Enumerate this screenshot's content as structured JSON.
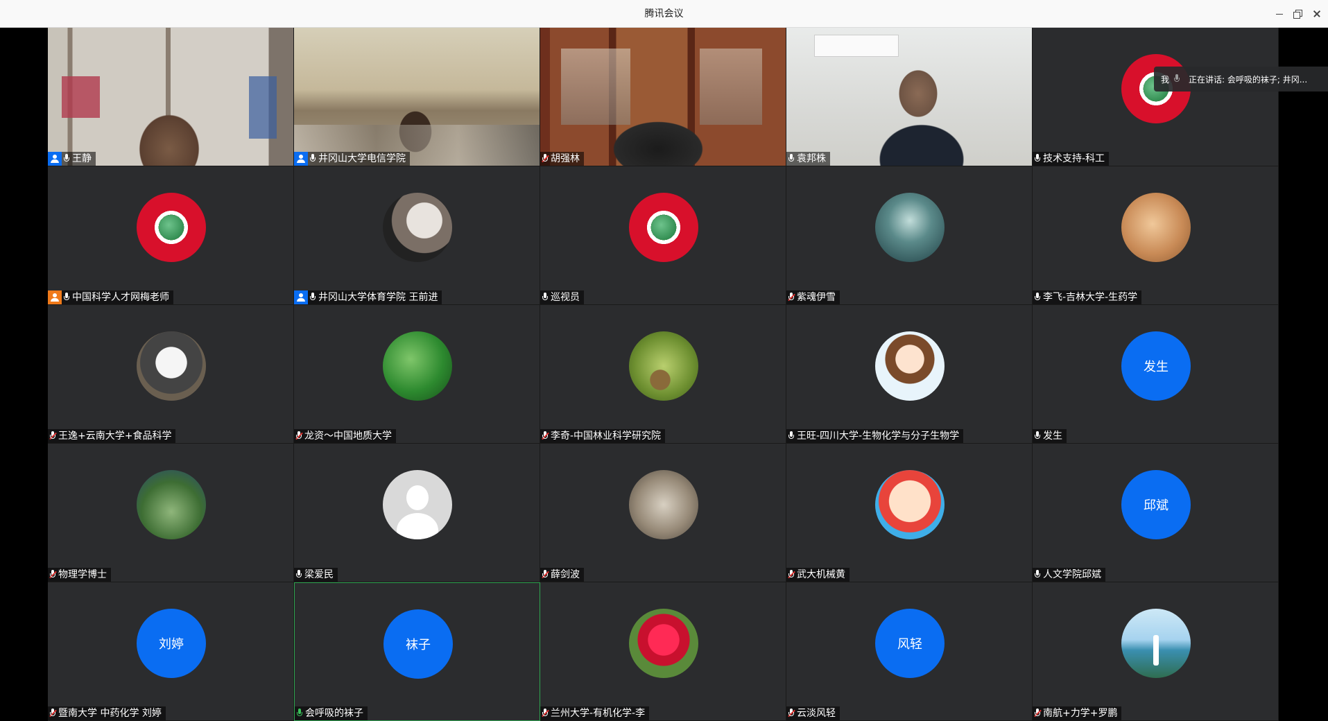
{
  "window": {
    "title": "腾讯会议"
  },
  "speaking": {
    "me_label": "我",
    "text": "正在讲话: 会呼吸的袜子; 井冈..."
  },
  "participants": [
    {
      "name": "王静",
      "badge": "host",
      "mic": "on",
      "view": "video",
      "style": "v1"
    },
    {
      "name": "井冈山大学电信学院",
      "badge": "host",
      "mic": "on",
      "view": "video",
      "style": "v2"
    },
    {
      "name": "胡强林",
      "badge": "",
      "mic": "muted",
      "view": "video",
      "style": "v3"
    },
    {
      "name": "袁邦株",
      "badge": "",
      "mic": "on",
      "view": "video",
      "style": "v4"
    },
    {
      "name": "技术支持-科工",
      "badge": "",
      "mic": "on",
      "view": "avatar",
      "avatar": "av-logo"
    },
    {
      "name": "中国科学人才网梅老师",
      "badge": "cohost",
      "mic": "on",
      "view": "avatar",
      "avatar": "av-logo"
    },
    {
      "name": "井冈山大学体育学院 王前进",
      "badge": "host",
      "mic": "on",
      "view": "avatar",
      "avatar": "av-portrait"
    },
    {
      "name": "巡视员",
      "badge": "",
      "mic": "on",
      "view": "avatar",
      "avatar": "av-logo"
    },
    {
      "name": "紫魂伊雪",
      "badge": "",
      "mic": "muted",
      "view": "avatar",
      "avatar": "av-wave"
    },
    {
      "name": "李飞-吉林大学-生药学",
      "badge": "",
      "mic": "on",
      "view": "avatar",
      "avatar": "av-cat"
    },
    {
      "name": "王逸+云南大学+食品科学",
      "badge": "",
      "mic": "muted",
      "view": "avatar",
      "avatar": "av-cartoon"
    },
    {
      "name": "龙资～中国地质大学",
      "badge": "",
      "mic": "muted",
      "view": "avatar",
      "avatar": "av-clover"
    },
    {
      "name": "李奇-中国林业科学研究院",
      "badge": "",
      "mic": "muted",
      "view": "avatar",
      "avatar": "av-squirrel"
    },
    {
      "name": "王旺-四川大学-生物化学与分子生物学",
      "badge": "",
      "mic": "on",
      "view": "avatar",
      "avatar": "av-boy"
    },
    {
      "name": "发生",
      "badge": "",
      "mic": "on",
      "view": "text",
      "avatar_text": "发生"
    },
    {
      "name": "物理学博士",
      "badge": "",
      "mic": "muted",
      "view": "avatar",
      "avatar": "av-plant"
    },
    {
      "name": "梁爱民",
      "badge": "",
      "mic": "on",
      "view": "avatar",
      "avatar": "av-default"
    },
    {
      "name": "薛剑波",
      "badge": "",
      "mic": "muted",
      "view": "avatar",
      "avatar": "av-hedgehog"
    },
    {
      "name": "武大机械黄",
      "badge": "",
      "mic": "muted",
      "view": "avatar",
      "avatar": "av-shin"
    },
    {
      "name": "人文学院邱斌",
      "badge": "",
      "mic": "on",
      "view": "text",
      "avatar_text": "邱斌"
    },
    {
      "name": "暨南大学  中药化学   刘婷",
      "badge": "",
      "mic": "muted",
      "view": "text",
      "avatar_text": "刘婷"
    },
    {
      "name": "会呼吸的袜子",
      "badge": "",
      "mic": "speaking",
      "view": "text",
      "avatar_text": "袜子",
      "active": true
    },
    {
      "name": "兰州大学-有机化学-李",
      "badge": "",
      "mic": "muted",
      "view": "avatar",
      "avatar": "av-flower"
    },
    {
      "name": "云淡风轻",
      "badge": "",
      "mic": "muted",
      "view": "text",
      "avatar_text": "风轻"
    },
    {
      "name": "南航+力学+罗鹏",
      "badge": "",
      "mic": "muted",
      "view": "avatar",
      "avatar": "av-lake"
    }
  ]
}
